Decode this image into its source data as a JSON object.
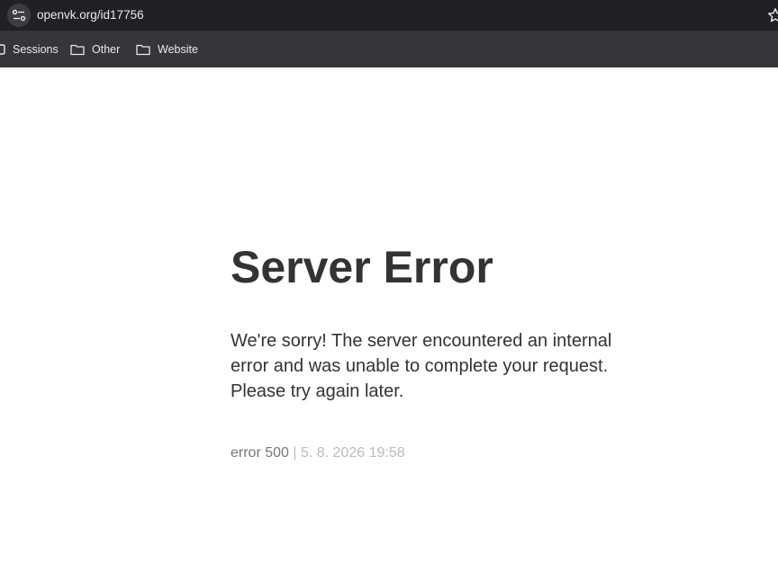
{
  "browser": {
    "url": "openvk.org/id17756",
    "bookmarks": [
      {
        "label": "Sessions",
        "icon": "bookmark-icon"
      },
      {
        "label": "Other",
        "icon": "folder-icon"
      },
      {
        "label": "Website",
        "icon": "folder-icon"
      }
    ]
  },
  "page": {
    "title": "Server Error",
    "message": "We're sorry! The server encountered an internal error and was unable to complete your request. Please try again later.",
    "error_code": "error 500",
    "separator": " | ",
    "timestamp": "5. 8. 2026 19:58"
  },
  "colors": {
    "toolbar_bg": "#202124",
    "bookmarks_bg": "#35363a",
    "heading_text": "#333333",
    "muted_text": "#777777",
    "faint_text": "#bbbbbb"
  }
}
